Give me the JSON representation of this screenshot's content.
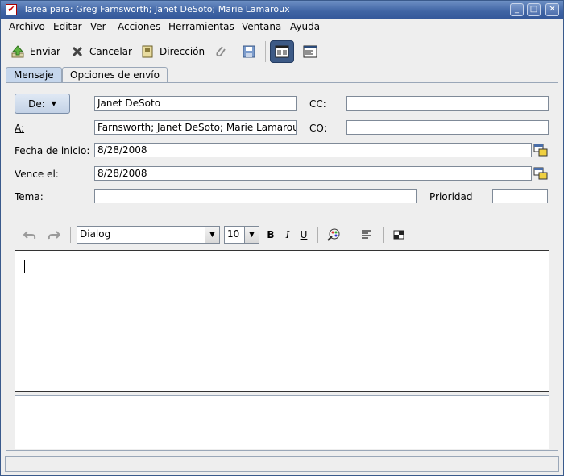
{
  "window": {
    "title": "Tarea para: Greg Farnsworth; Janet DeSoto; Marie Lamaroux"
  },
  "menu": [
    "Archivo",
    "Editar",
    "Ver",
    "Acciones",
    "Herramientas",
    "Ventana",
    "Ayuda"
  ],
  "toolbar": {
    "send": "Enviar",
    "cancel": "Cancelar",
    "address": "Dirección"
  },
  "tabs": [
    "Mensaje",
    "Opciones de envío"
  ],
  "form": {
    "from_button": "De:",
    "from_value": "Janet DeSoto",
    "cc_label": "CC:",
    "cc_value": "",
    "to_label": "A:",
    "to_value": "Farnsworth; Janet DeSoto; Marie Lamaroux",
    "bcc_label": "CO:",
    "bcc_value": "",
    "start_label": "Fecha de inicio:",
    "start_value": "8/28/2008",
    "due_label": "Vence el:",
    "due_value": "8/28/2008",
    "subject_label": "Tema:",
    "subject_value": "",
    "priority_label": "Prioridad",
    "priority_value": ""
  },
  "format": {
    "font": "Dialog",
    "size": "10",
    "bold": "B",
    "italic": "I",
    "underline": "U"
  },
  "colors": {
    "titlebar": "#3f64a4",
    "tab_selected": "#c5d6ec",
    "active_button": "#3d5a86"
  }
}
